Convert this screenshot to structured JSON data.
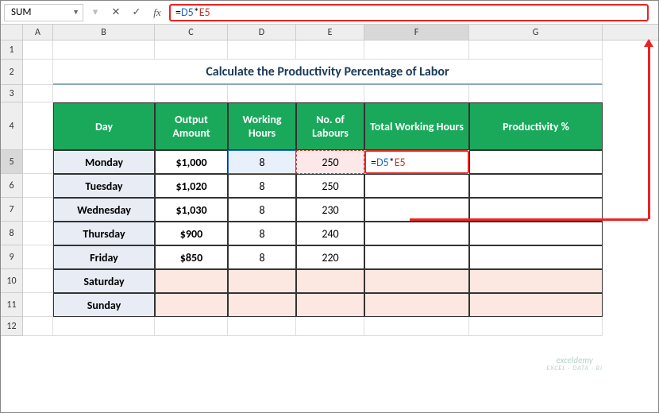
{
  "namebox": "SUM",
  "formula_bar": {
    "eq": "=",
    "ref1": "D5",
    "op": "*",
    "ref2": "E5"
  },
  "cols": {
    "A": "A",
    "B": "B",
    "C": "C",
    "D": "D",
    "E": "E",
    "F": "F",
    "G": "G"
  },
  "rows": [
    "1",
    "2",
    "3",
    "4",
    "5",
    "6",
    "7",
    "8",
    "9",
    "10",
    "11",
    "12"
  ],
  "title": "Calculate the Productivity Percentage of Labor",
  "headers": {
    "day": "Day",
    "output": "Output Amount",
    "hours": "Working Hours",
    "labours": "No. of Labours",
    "total": "Total Working Hours",
    "prod": "Productivity %"
  },
  "data": [
    {
      "day": "Monday",
      "output": "$1,000",
      "hours": "8",
      "labours": "250"
    },
    {
      "day": "Tuesday",
      "output": "$1,020",
      "hours": "8",
      "labours": "250"
    },
    {
      "day": "Wednesday",
      "output": "$1,030",
      "hours": "8",
      "labours": "230"
    },
    {
      "day": "Thursday",
      "output": "$900",
      "hours": "8",
      "labours": "240"
    },
    {
      "day": "Friday",
      "output": "$850",
      "hours": "8",
      "labours": "220"
    },
    {
      "day": "Saturday",
      "output": "",
      "hours": "",
      "labours": ""
    },
    {
      "day": "Sunday",
      "output": "",
      "hours": "",
      "labours": ""
    }
  ],
  "f5": {
    "eq": "=",
    "ref1": "D5",
    "op": "*",
    "ref2": "E5"
  },
  "watermark": {
    "name": "exceldemy",
    "sub": "EXCEL · DATA · BI"
  },
  "chart_data": {
    "type": "table",
    "title": "Calculate the Productivity Percentage of Labor",
    "columns": [
      "Day",
      "Output Amount",
      "Working Hours",
      "No. of Labours",
      "Total Working Hours",
      "Productivity %"
    ],
    "rows": [
      [
        "Monday",
        1000,
        8,
        250,
        null,
        null
      ],
      [
        "Tuesday",
        1020,
        8,
        250,
        null,
        null
      ],
      [
        "Wednesday",
        1030,
        8,
        230,
        null,
        null
      ],
      [
        "Thursday",
        900,
        8,
        240,
        null,
        null
      ],
      [
        "Friday",
        850,
        8,
        220,
        null,
        null
      ],
      [
        "Saturday",
        null,
        null,
        null,
        null,
        null
      ],
      [
        "Sunday",
        null,
        null,
        null,
        null,
        null
      ]
    ],
    "formula": {
      "cell": "F5",
      "text": "=D5*E5"
    }
  }
}
